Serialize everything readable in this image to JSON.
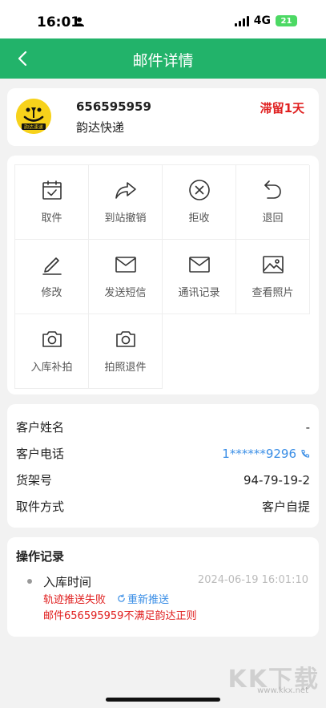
{
  "status_bar": {
    "time": "16:01",
    "network": "4G",
    "battery": "21"
  },
  "nav": {
    "title": "邮件详情"
  },
  "package": {
    "tracking_number": "656595959",
    "company": "韵达快递",
    "logo_text": "韵达速递",
    "status": "滞留1天"
  },
  "actions": [
    {
      "label": "取件",
      "icon": "calendar-check-icon"
    },
    {
      "label": "到站撤销",
      "icon": "share-arrow-icon"
    },
    {
      "label": "拒收",
      "icon": "circle-x-icon"
    },
    {
      "label": "退回",
      "icon": "undo-icon"
    },
    {
      "label": "修改",
      "icon": "pencil-icon"
    },
    {
      "label": "发送短信",
      "icon": "envelope-icon"
    },
    {
      "label": "通讯记录",
      "icon": "envelope-icon"
    },
    {
      "label": "查看照片",
      "icon": "image-icon"
    },
    {
      "label": "入库补拍",
      "icon": "camera-icon"
    },
    {
      "label": "拍照退件",
      "icon": "camera-icon"
    }
  ],
  "info": [
    {
      "label": "客户姓名",
      "value": "-"
    },
    {
      "label": "客户电话",
      "value": "1******9296"
    },
    {
      "label": "货架号",
      "value": "94-79-19-2"
    },
    {
      "label": "取件方式",
      "value": "客户自提"
    }
  ],
  "log": {
    "title": "操作记录",
    "event": "入库时间",
    "time": "2024-06-19 16:01:10",
    "error": "轨迹推送失败",
    "retry_label": "重新推送",
    "reason": "邮件656595959不满足韵达正则"
  },
  "watermark": {
    "brand": "KK下载",
    "url": "www.kkx.net"
  },
  "colors": {
    "primary": "#22b36a",
    "alert": "#e02020",
    "link": "#3a8ee6"
  }
}
